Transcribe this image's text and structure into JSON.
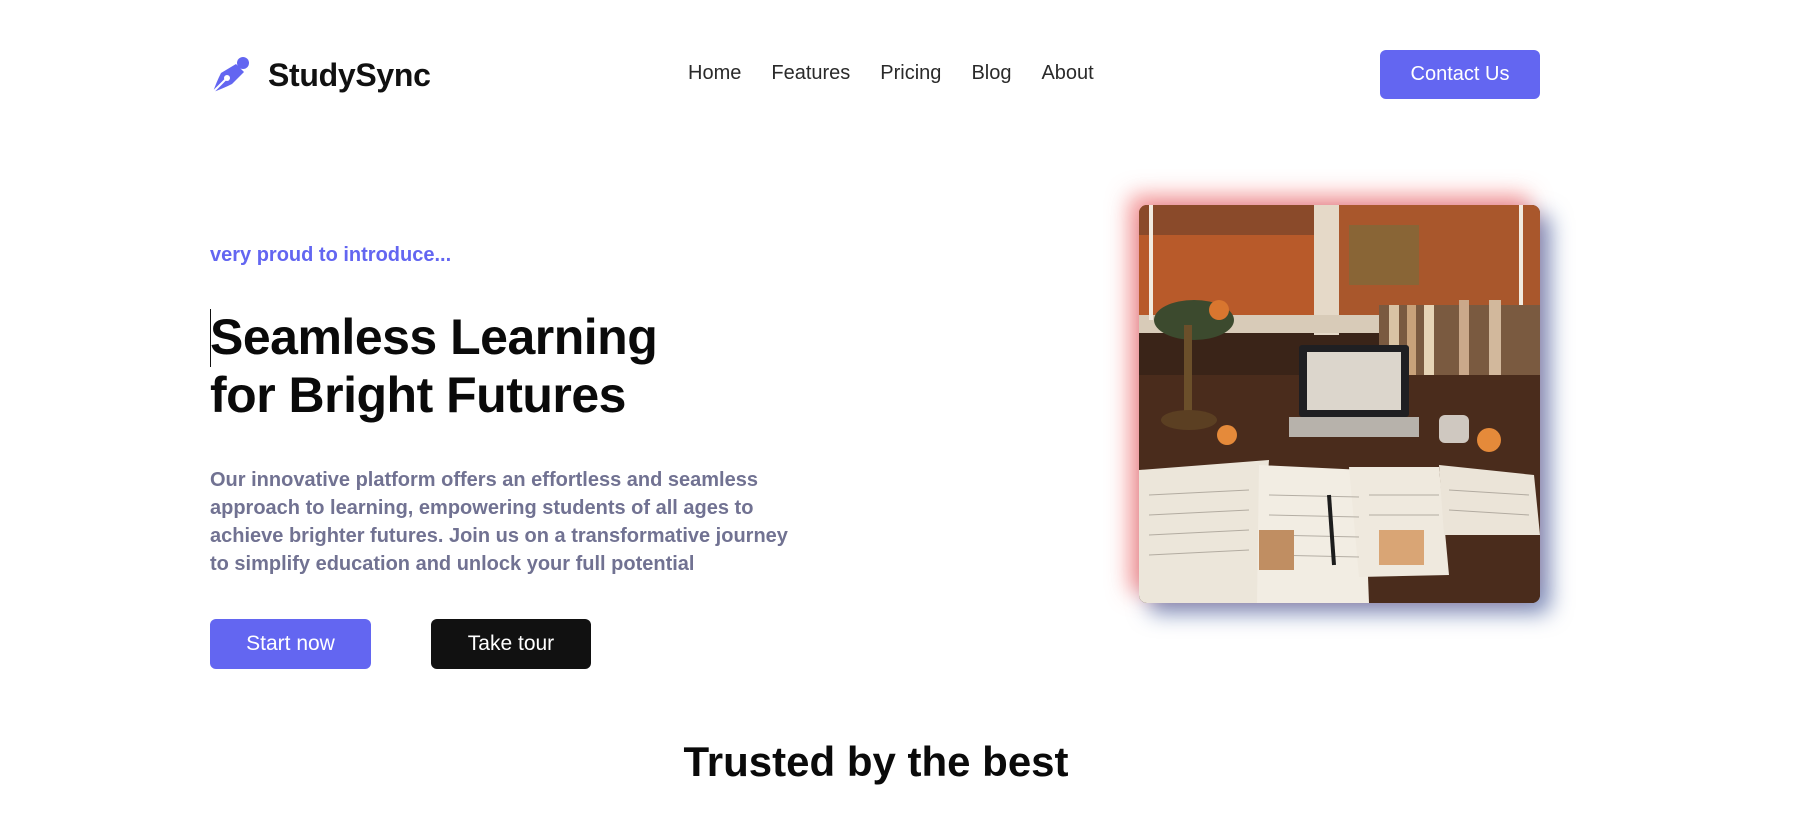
{
  "header": {
    "brand": "StudySync",
    "nav": [
      "Home",
      "Features",
      "Pricing",
      "Blog",
      "About"
    ],
    "contact_label": "Contact Us"
  },
  "hero": {
    "eyebrow": "very proud to introduce...",
    "headline_line1": "Seamless Learning",
    "headline_line2": "for Bright Futures",
    "description": "Our innovative platform offers an effortless and seamless approach to learning, empowering students of all ages to achieve brighter futures. Join us on a transformative journey to simplify education and unlock your full potential",
    "start_label": "Start now",
    "tour_label": "Take tour"
  },
  "trusted": {
    "heading": "Trusted by the best"
  },
  "colors": {
    "accent": "#6366f1",
    "dark_button": "#111111",
    "muted_text": "#717292"
  },
  "icons": {
    "brand": "pen-nib-icon"
  }
}
